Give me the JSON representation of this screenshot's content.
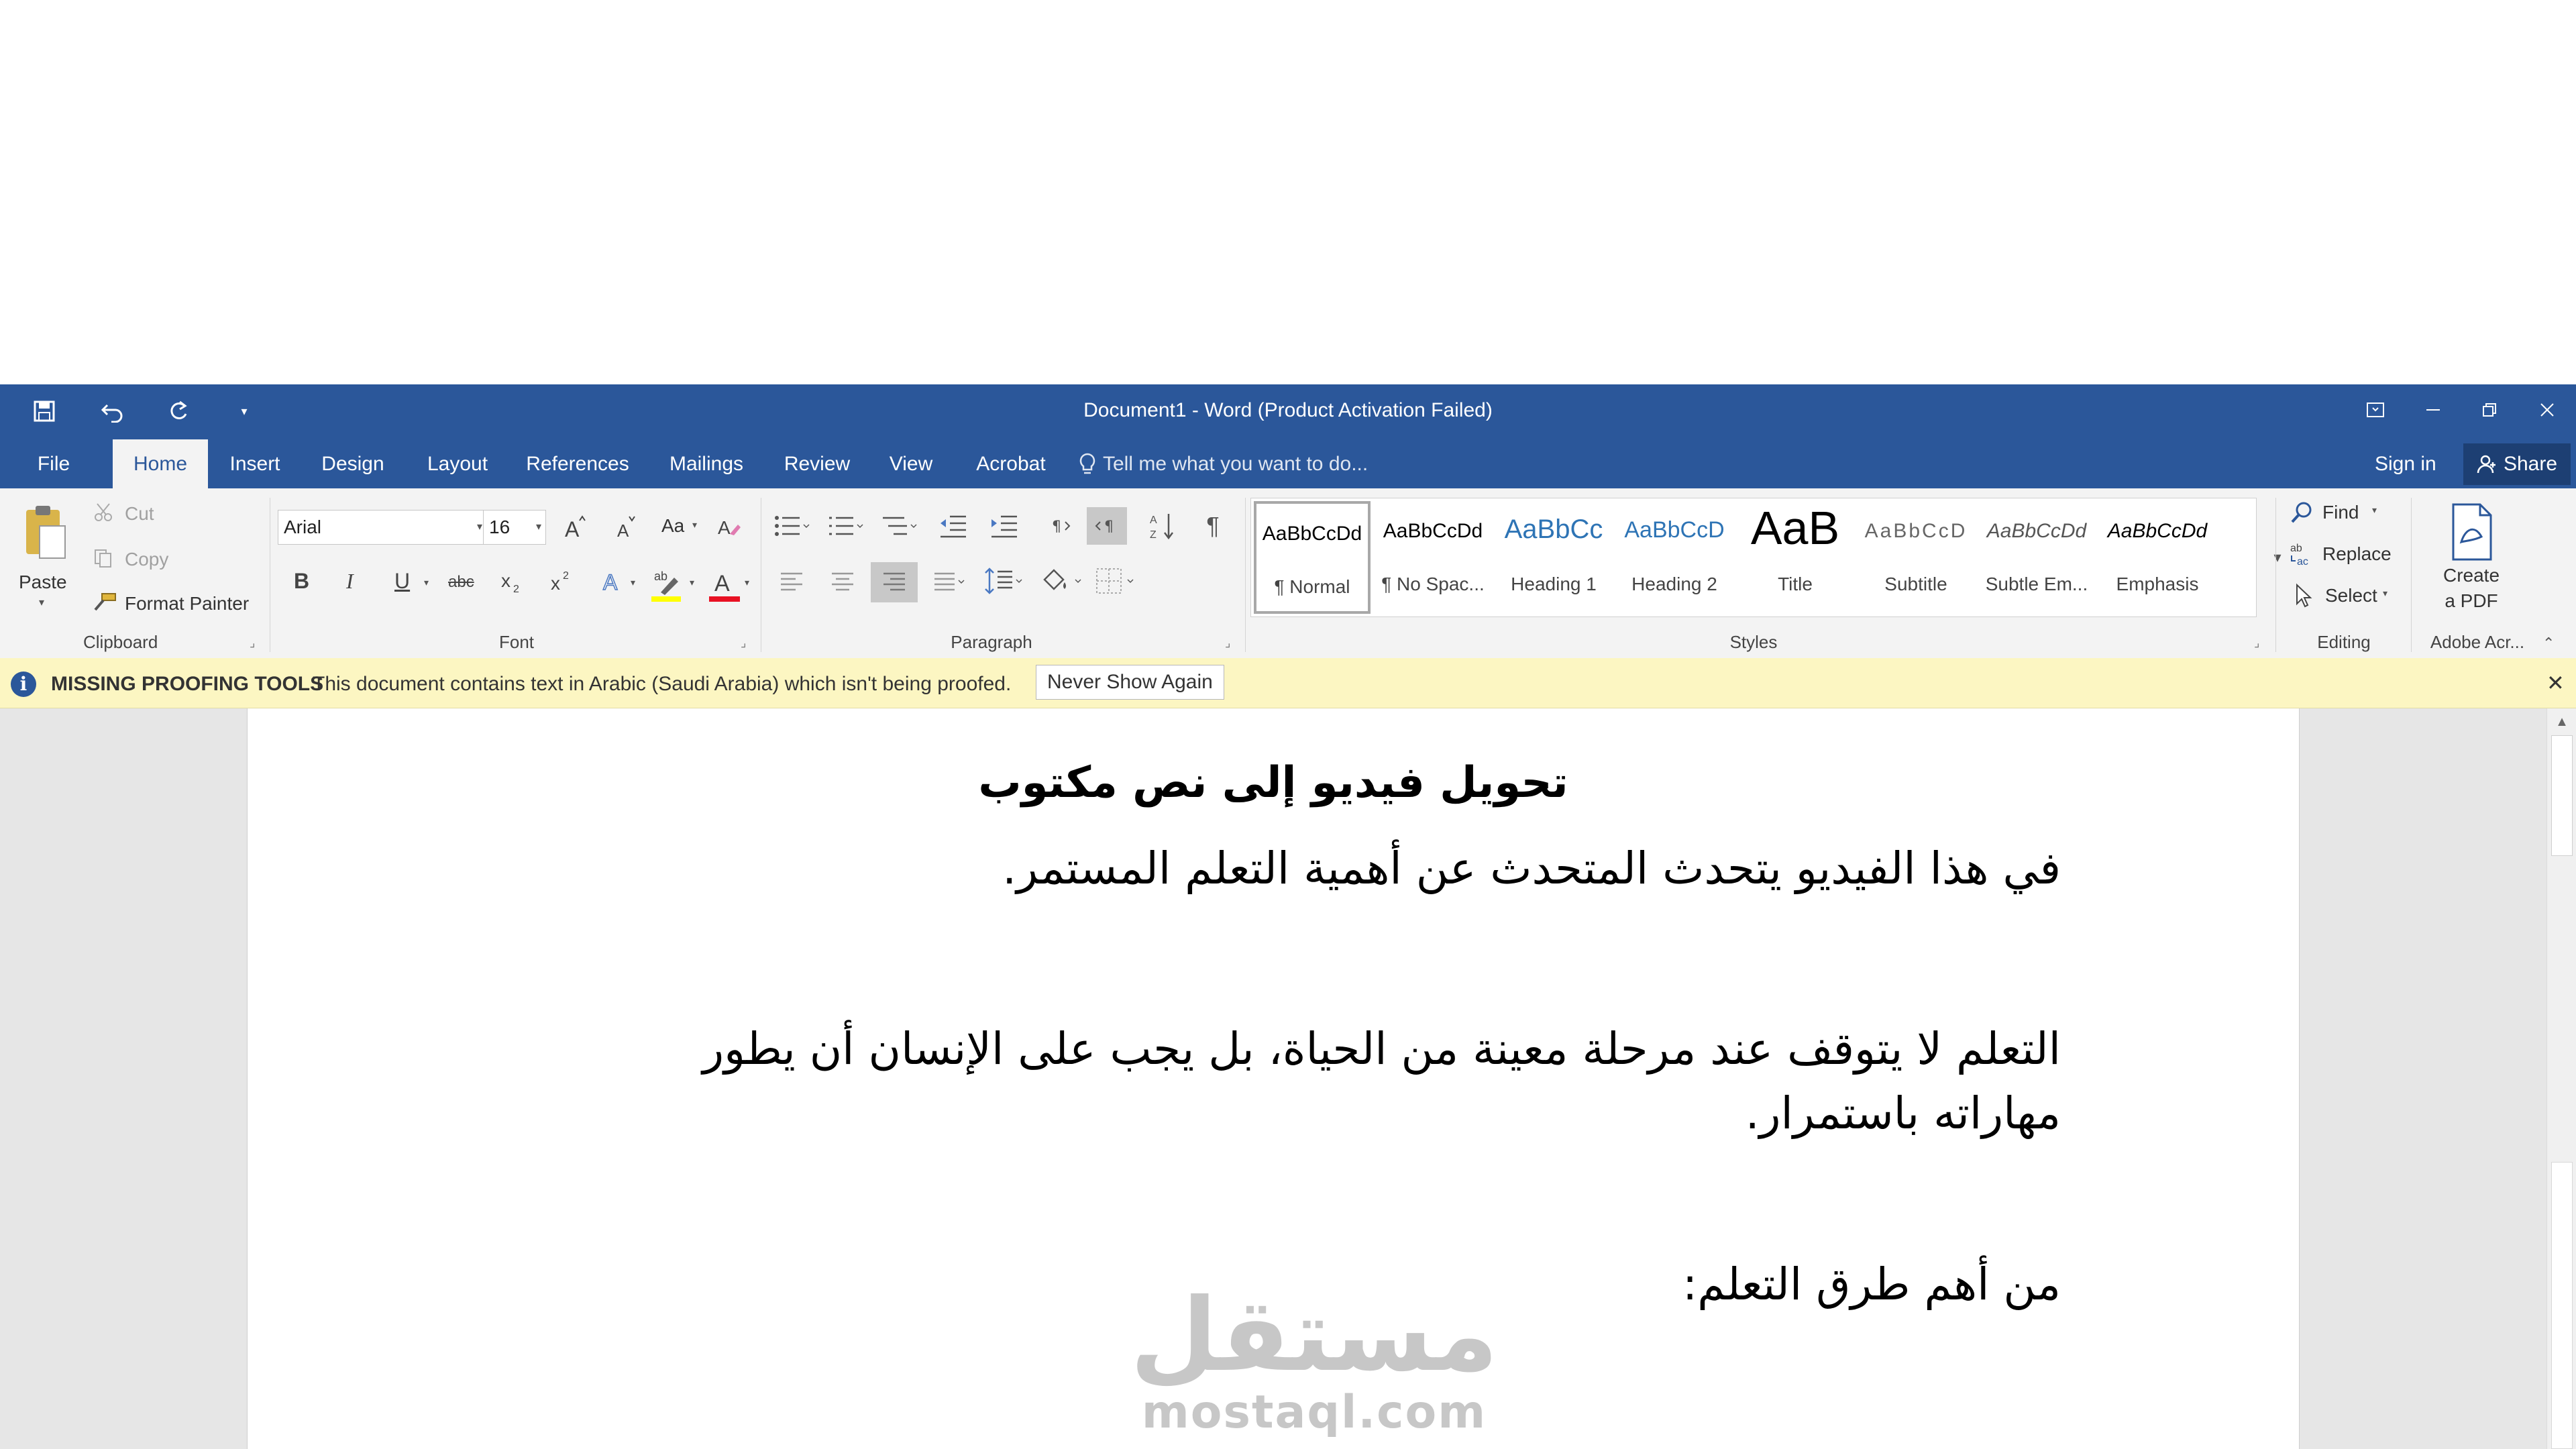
{
  "window": {
    "title": "Document1 - Word (Product Activation Failed)",
    "accent": "#2b579a"
  },
  "qat": {
    "icons": [
      "save-icon",
      "undo-icon",
      "redo-icon",
      "customize-qat-icon"
    ]
  },
  "tabs": [
    "File",
    "Home",
    "Insert",
    "Design",
    "Layout",
    "References",
    "Mailings",
    "Review",
    "View",
    "Acrobat"
  ],
  "active_tab": "Home",
  "tell_me": "Tell me what you want to do...",
  "account": {
    "sign_in": "Sign in",
    "share": "Share"
  },
  "ribbon": {
    "clipboard": {
      "label": "Clipboard",
      "paste": "Paste",
      "cut": "Cut",
      "copy": "Copy",
      "format_painter": "Format Painter"
    },
    "font": {
      "label": "Font",
      "family": "Arial",
      "size": "16",
      "change_case": "Aa",
      "bold": "B",
      "italic": "I",
      "underline": "U",
      "strike": "abc",
      "font_color": "#e81123",
      "highlight_color": "#ffff00"
    },
    "paragraph": {
      "label": "Paragraph"
    },
    "styles": {
      "label": "Styles",
      "items": [
        {
          "preview": "AaBbCcDd",
          "name": "¶ Normal"
        },
        {
          "preview": "AaBbCcDd",
          "name": "¶ No Spac..."
        },
        {
          "preview": "AaBbCc",
          "name": "Heading 1"
        },
        {
          "preview": "AaBbCcD",
          "name": "Heading 2"
        },
        {
          "preview": "AaB",
          "name": "Title"
        },
        {
          "preview": "AaBbCcD",
          "name": "Subtitle"
        },
        {
          "preview": "AaBbCcDd",
          "name": "Subtle Em..."
        },
        {
          "preview": "AaBbCcDd",
          "name": "Emphasis"
        }
      ]
    },
    "editing": {
      "label": "Editing",
      "find": "Find",
      "replace": "Replace",
      "select": "Select"
    },
    "acrobat": {
      "label": "Adobe Acr...",
      "create_line1": "Create",
      "create_line2": "a PDF"
    }
  },
  "infobar": {
    "title": "MISSING PROOFING TOOLS",
    "message": "This document contains text in Arabic (Saudi Arabia) which isn't being proofed.",
    "button": "Never Show Again"
  },
  "document": {
    "heading": "تحويل فيديو إلى نص مكتوب",
    "p1": "في هذا الفيديو يتحدث المتحدث عن أهمية التعلم المستمر.",
    "p2": "التعلم لا يتوقف عند مرحلة معينة من الحياة، بل يجب على الإنسان أن يطور مهاراته باستمرار.",
    "p3": "من أهم طرق التعلم:"
  },
  "watermark": {
    "arabic": "مستقل",
    "latin": "mostaql.com"
  }
}
